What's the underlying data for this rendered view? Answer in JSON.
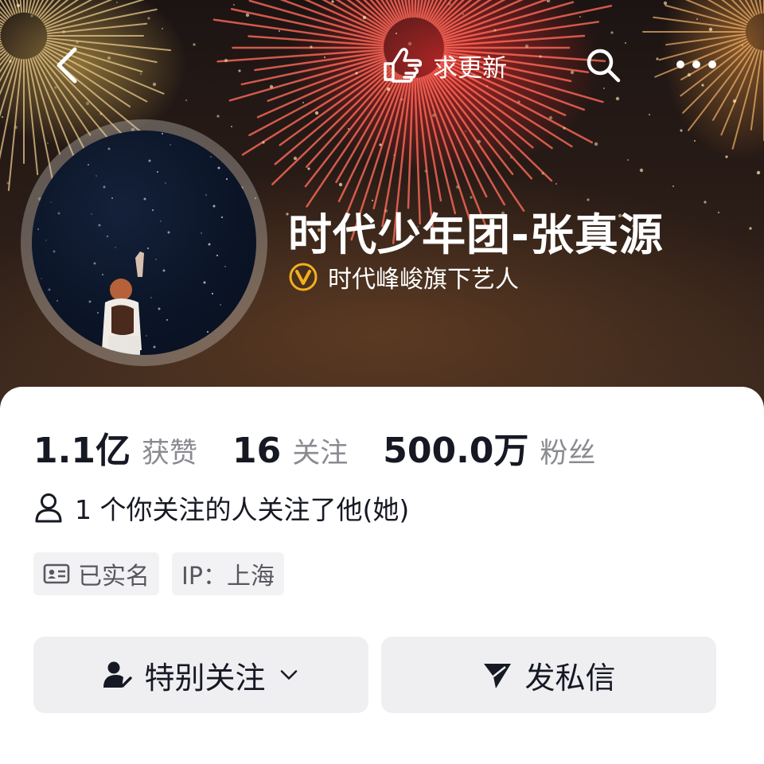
{
  "header": {
    "back_icon": "chevron-left-icon",
    "update_label": "求更新",
    "update_icon": "pointing-hand-icon",
    "search_icon": "search-icon",
    "more_icon": "more-dots-icon"
  },
  "profile": {
    "name": "时代少年团-张真源",
    "verification": "时代峰峻旗下艺人",
    "verification_icon": "verified-v-badge-icon",
    "verification_color": "#f2b01e"
  },
  "stats": [
    {
      "value": "1.1亿",
      "label": "获赞"
    },
    {
      "value": "16",
      "label": "关注"
    },
    {
      "value": "500.0万",
      "label": "粉丝"
    }
  ],
  "mutual": {
    "icon": "person-outline-icon",
    "text": "1 个你关注的人关注了他(她)"
  },
  "tags": [
    {
      "icon": "id-card-icon",
      "label": "已实名"
    },
    {
      "label": "IP：上海"
    }
  ],
  "actions": {
    "follow": {
      "icon": "person-check-icon",
      "label": "特别关注",
      "dropdown_icon": "chevron-down-icon"
    },
    "message": {
      "icon": "send-icon",
      "label": "发私信"
    }
  },
  "colors": {
    "text_primary": "#161823",
    "text_secondary": "#8a8b91",
    "tag_bg": "#f2f2f4",
    "button_bg": "#efeff1"
  }
}
